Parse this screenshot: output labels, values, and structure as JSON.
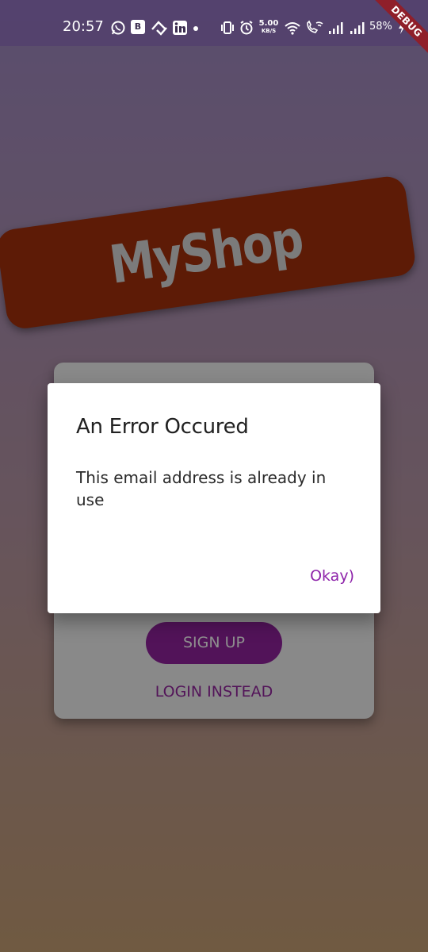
{
  "status_bar": {
    "time": "20:57",
    "badge_letter": "B",
    "network_speed_value": "5.00",
    "network_speed_unit": "KB/S",
    "battery_percent": "58%",
    "icons": [
      "whatsapp-icon",
      "b-app-icon",
      "relay-icon",
      "linkedin-icon",
      "dot-icon",
      "vibrate-icon",
      "alarm-icon",
      "wifi-icon",
      "wifi-calling-icon",
      "signal-icon",
      "signal-icon-2",
      "battery-charging-icon"
    ]
  },
  "debug_banner": {
    "label": "DEBUG"
  },
  "logo": {
    "text": "MyShop"
  },
  "auth_card": {
    "signup_label": "SIGN UP",
    "login_instead_label": "LOGIN INSTEAD"
  },
  "dialog": {
    "title": "An Error Occured",
    "message": "This email address is already in use",
    "action_label": "Okay)"
  },
  "colors": {
    "logo_banner": "#5d1b06",
    "signup_button": "#521359",
    "dialog_action": "#8e24aa",
    "debug_ribbon": "#8f1f2a"
  }
}
